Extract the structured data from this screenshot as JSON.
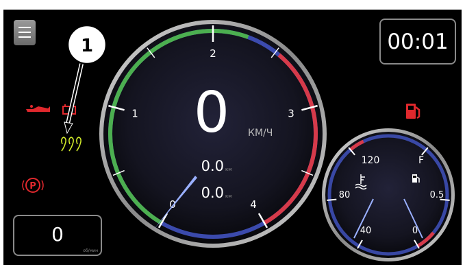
{
  "callout": {
    "number": "1"
  },
  "clock": {
    "time": "00:01"
  },
  "odometer": {
    "value": "0",
    "unit": "об/мин"
  },
  "speedometer": {
    "speed": "0",
    "speed_unit": "КМ/Ч",
    "trip_a": "0.0",
    "trip_b": "0.0",
    "trip_unit": "км",
    "scale_labels": [
      "0",
      "1",
      "2",
      "3",
      "4"
    ]
  },
  "small_gauge": {
    "temp_labels": [
      "120",
      "80",
      "40"
    ],
    "fuel_labels": [
      "F",
      "0.5",
      "0"
    ]
  },
  "icons": {
    "oil": "oil-pressure-icon",
    "battery": "battery-icon",
    "glow": "glow-plug-icon",
    "parking": "parking-brake-icon",
    "fuel": "fuel-pump-icon",
    "coolant": "coolant-temp-icon",
    "fuel_small": "fuel-small-icon"
  },
  "colors": {
    "green": "#4caf50",
    "red": "#d63a4a",
    "glow_yellow": "#cde62a",
    "warning_red": "#e0282d",
    "ring_blue": "#5566d8"
  }
}
